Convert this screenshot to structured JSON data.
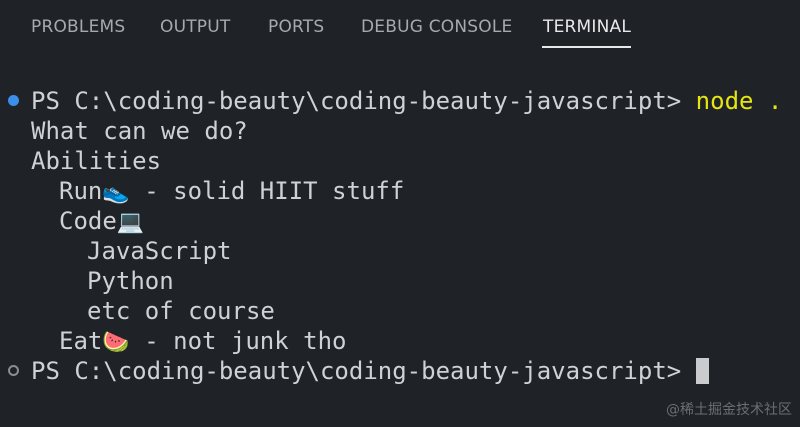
{
  "tabs": [
    {
      "label": "PROBLEMS"
    },
    {
      "label": "OUTPUT"
    },
    {
      "label": "PORTS"
    },
    {
      "label": "DEBUG CONSOLE"
    },
    {
      "label": "TERMINAL",
      "active": true
    }
  ],
  "terminal": {
    "prompt1": "PS C:\\coding-beauty\\coding-beauty-javascript> ",
    "command1": "node .",
    "output": {
      "line1": "What can we do?",
      "line2": "Abilities",
      "run_label": "Run",
      "run_emoji": "👟",
      "run_desc": " - solid HIIT stuff",
      "code_label": "Code",
      "code_emoji": "💻",
      "lang1": "JavaScript",
      "lang2": "Python",
      "lang3": "etc of course",
      "eat_label": "Eat",
      "eat_emoji": "🍉",
      "eat_desc": " - not junk tho"
    },
    "prompt2": "PS C:\\coding-beauty\\coding-beauty-javascript> "
  },
  "watermark": "@稀土掘金技术社区",
  "colors": {
    "background": "#1f2227",
    "command": "#e5e510",
    "status_dot_success": "#3b8eea"
  }
}
